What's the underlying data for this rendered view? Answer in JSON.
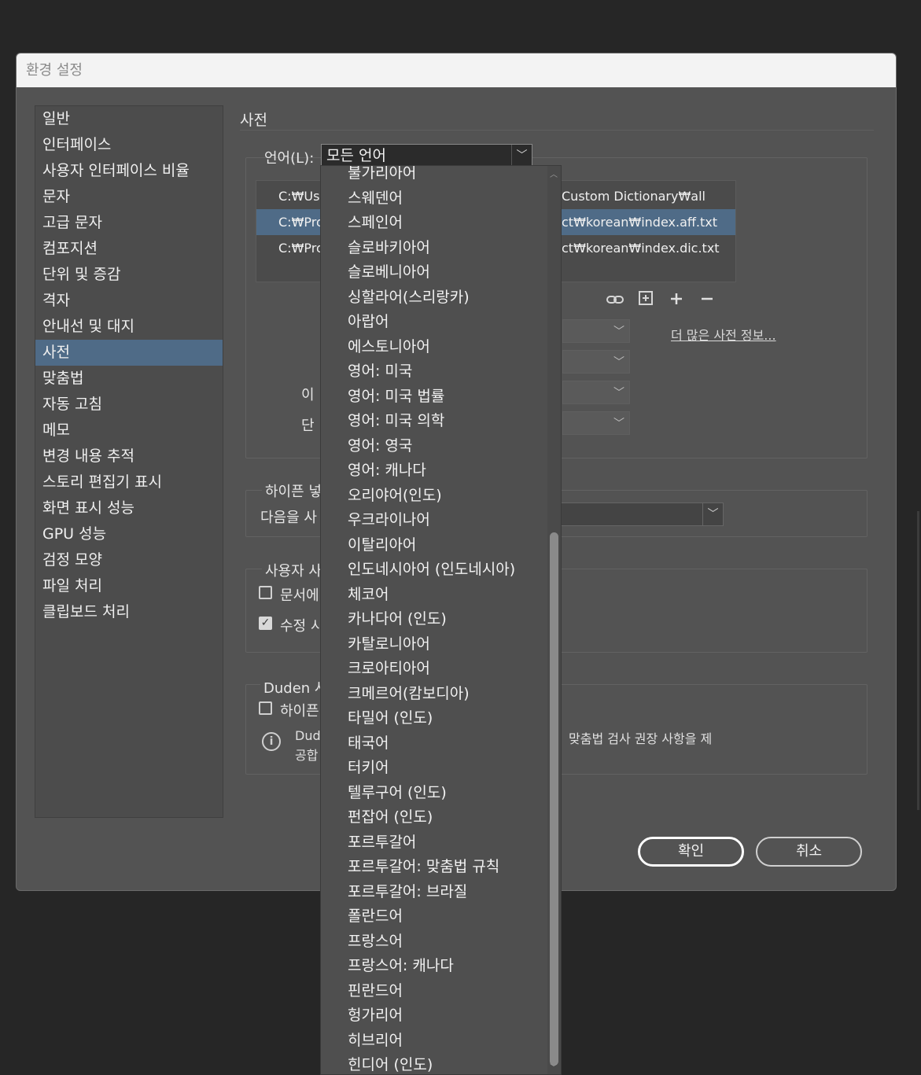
{
  "window": {
    "title": "환경 설정"
  },
  "sidebar": {
    "items": [
      {
        "label": "일반"
      },
      {
        "label": "인터페이스"
      },
      {
        "label": "사용자 인터페이스 비율"
      },
      {
        "label": "문자"
      },
      {
        "label": "고급 문자"
      },
      {
        "label": "컴포지션"
      },
      {
        "label": "단위 및 증감"
      },
      {
        "label": "격자"
      },
      {
        "label": "안내선 및 대지"
      },
      {
        "label": "사전",
        "selected": true
      },
      {
        "label": "맞춤법"
      },
      {
        "label": "자동 고침"
      },
      {
        "label": "메모"
      },
      {
        "label": "변경 내용 추적"
      },
      {
        "label": "스토리 편집기 표시"
      },
      {
        "label": "화면 표시 성능"
      },
      {
        "label": "GPU 성능"
      },
      {
        "label": "검정 모양"
      },
      {
        "label": "파일 처리"
      },
      {
        "label": "클립보드 처리"
      }
    ]
  },
  "main": {
    "title": "사전",
    "language_label": "언어(L):",
    "language_value": "모든 언어",
    "dict_rows": [
      {
        "left": "C:₩Use",
        "right": "Custom Dictionary₩all"
      },
      {
        "left": "C:₩Prog",
        "right": "ct₩korean₩index.aff.txt",
        "selected": true
      },
      {
        "left": "C:₩Prog",
        "right": "ct₩korean₩index.dic.txt"
      }
    ],
    "more_link": "더 많은 사전 정보...",
    "label_name_partial": "이",
    "label_word_partial": "단",
    "hyphen_section": "하이픈 넣",
    "hyphen_next": "다음을 사",
    "user_section": "사용자 사",
    "doc_checkbox": "문서에",
    "doc_checked": false,
    "modify_checkbox": "수정 시",
    "modify_checked": true,
    "duden_section": "Duden 사",
    "hyphen_checkbox": "하이픈",
    "hyphen_checked": false,
    "info_line1_left": "Dud",
    "info_line2_left": "공합",
    "info_right": "맞춤법 검사 권장 사항을 제"
  },
  "buttons": {
    "ok": "확인",
    "cancel": "취소"
  },
  "language_dropdown": {
    "options": [
      "불가리아어",
      "스웨덴어",
      "스페인어",
      "슬로바키아어",
      "슬로베니아어",
      "싱할라어(스리랑카)",
      "아랍어",
      "에스토니아어",
      "영어: 미국",
      "영어: 미국 법률",
      "영어: 미국 의학",
      "영어: 영국",
      "영어: 캐나다",
      "오리야어(인도)",
      "우크라이나어",
      "이탈리아어",
      "인도네시아어 (인도네시아)",
      "체코어",
      "카나다어 (인도)",
      "카탈로니아어",
      "크로아티아어",
      "크메르어(캄보디아)",
      "타밀어 (인도)",
      "태국어",
      "터키어",
      "텔루구어 (인도)",
      "펀잡어 (인도)",
      "포르투갈어",
      "포르투갈어: 맞춤법 규칙",
      "포르투갈어: 브라질",
      "폴란드어",
      "프랑스어",
      "프랑스어: 캐나다",
      "핀란드어",
      "헝가리어",
      "히브리어",
      "힌디어 (인도)"
    ]
  },
  "colors": {
    "selection": "#4f6b87",
    "dialog_bg": "#535353",
    "app_bg": "#262626"
  }
}
